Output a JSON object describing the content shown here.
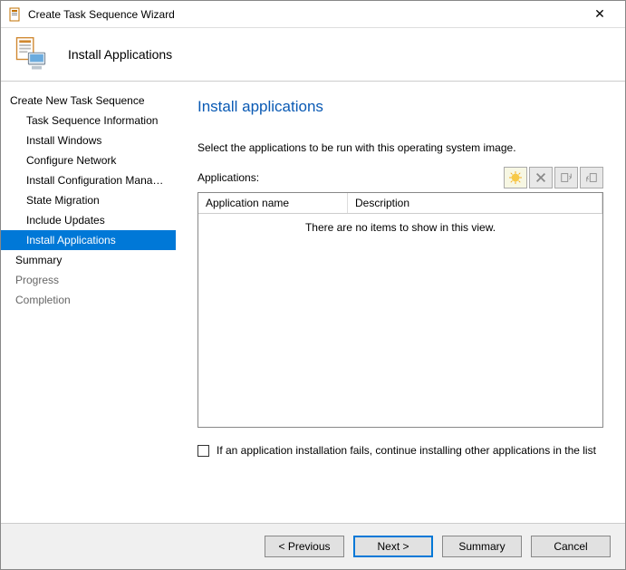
{
  "window": {
    "title": "Create Task Sequence Wizard"
  },
  "header": {
    "page_title": "Install Applications"
  },
  "sidebar": {
    "group": "Create New Task Sequence",
    "items": [
      {
        "label": "Task Sequence Information",
        "selected": false,
        "indent": 2,
        "muted": false
      },
      {
        "label": "Install Windows",
        "selected": false,
        "indent": 2,
        "muted": false
      },
      {
        "label": "Configure Network",
        "selected": false,
        "indent": 2,
        "muted": false
      },
      {
        "label": "Install Configuration Manager",
        "selected": false,
        "indent": 2,
        "muted": false
      },
      {
        "label": "State Migration",
        "selected": false,
        "indent": 2,
        "muted": false
      },
      {
        "label": "Include Updates",
        "selected": false,
        "indent": 2,
        "muted": false
      },
      {
        "label": "Install Applications",
        "selected": true,
        "indent": 2,
        "muted": false
      },
      {
        "label": "Summary",
        "selected": false,
        "indent": 1,
        "muted": false
      },
      {
        "label": "Progress",
        "selected": false,
        "indent": 1,
        "muted": true
      },
      {
        "label": "Completion",
        "selected": false,
        "indent": 1,
        "muted": true
      }
    ]
  },
  "main": {
    "heading": "Install applications",
    "instruction": "Select the applications to be run with this operating system image.",
    "applications_label": "Applications:",
    "columns": {
      "name": "Application name",
      "desc": "Description"
    },
    "empty_text": "There are no items to show in this view.",
    "checkbox_label": "If an application installation fails, continue installing other applications in the list",
    "checkbox_checked": false,
    "toolbar": {
      "new_enabled": true,
      "delete_enabled": false,
      "moveup_enabled": false,
      "movedown_enabled": false
    }
  },
  "footer": {
    "previous": "< Previous",
    "next": "Next >",
    "summary": "Summary",
    "cancel": "Cancel"
  }
}
